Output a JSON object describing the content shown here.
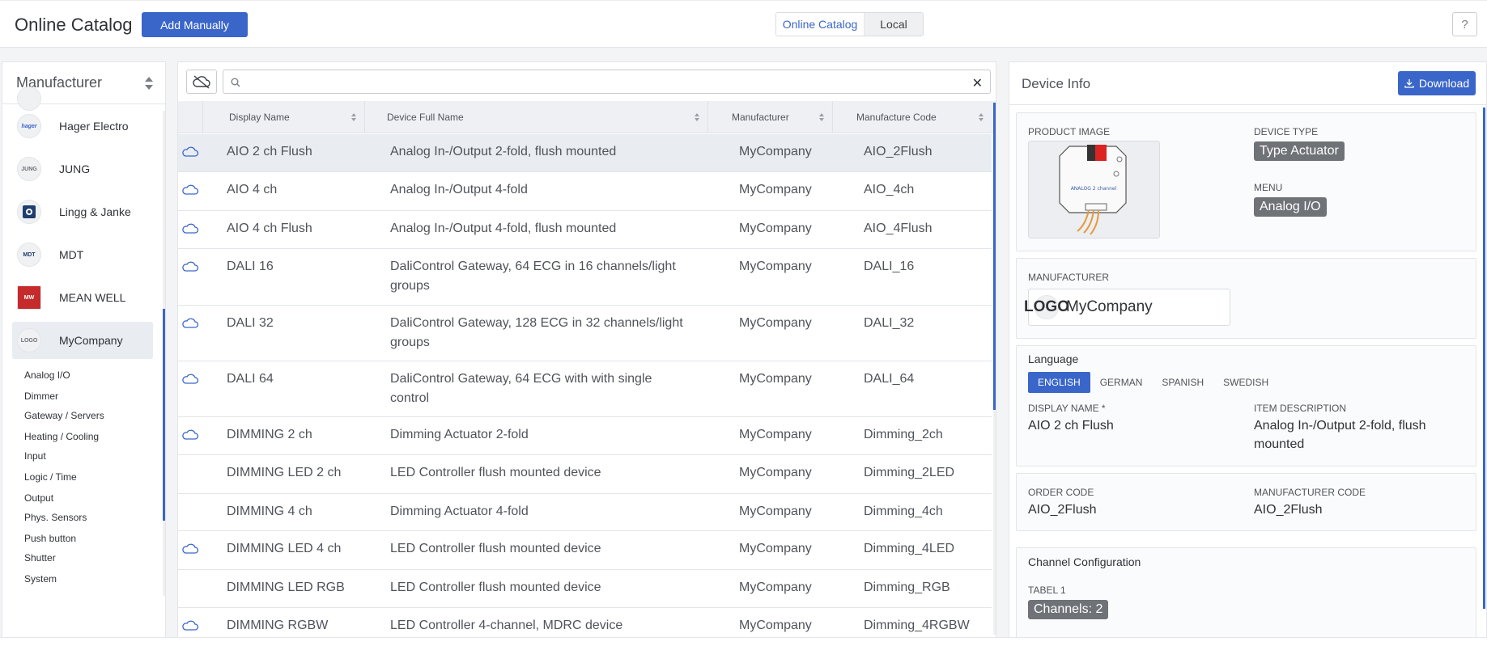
{
  "header": {
    "title": "Online Catalog",
    "add_manually_label": "Add Manually",
    "tabs": [
      "Online Catalog",
      "Local"
    ],
    "help_label": "?"
  },
  "left": {
    "header": "Manufacturer",
    "manufacturers": [
      {
        "name": "Hager Electro",
        "logo": "hager"
      },
      {
        "name": "JUNG",
        "logo": "JUNG"
      },
      {
        "name": "Lingg & Janke",
        "logo": ""
      },
      {
        "name": "MDT",
        "logo": "MDT"
      },
      {
        "name": "MEAN WELL",
        "logo": "MW"
      },
      {
        "name": "MyCompany",
        "logo": "LOGO"
      }
    ],
    "categories": [
      "Analog I/O",
      "Dimmer",
      "Gateway / Servers",
      "Heating / Cooling",
      "Input",
      "Logic / Time",
      "Output",
      "Phys. Sensors",
      "Push button",
      "Shutter",
      "System"
    ]
  },
  "middle": {
    "search_placeholder": "",
    "columns": [
      "Display Name",
      "Device Full Name",
      "Manufacturer",
      "Manufacture Code"
    ],
    "rows": [
      {
        "display": "AIO 2 ch Flush",
        "full": "Analog In-/Output 2-fold, flush mounted",
        "full2": "",
        "mfr": "MyCompany",
        "code": "AIO_2Flush",
        "cloud": true
      },
      {
        "display": "AIO 4 ch",
        "full": "Analog In-/Output 4-fold",
        "full2": "",
        "mfr": "MyCompany",
        "code": "AIO_4ch",
        "cloud": true
      },
      {
        "display": "AIO 4 ch Flush",
        "full": "Analog In-/Output 4-fold, flush mounted",
        "full2": "",
        "mfr": "MyCompany",
        "code": "AIO_4Flush",
        "cloud": true
      },
      {
        "display": "DALI 16",
        "full": "DaliControl Gateway, 64 ECG in 16 channels/light",
        "full2": "groups",
        "mfr": "MyCompany",
        "code": "DALI_16",
        "cloud": true
      },
      {
        "display": "DALI 32",
        "full": "DaliControl Gateway, 128 ECG in 32 channels/light",
        "full2": "groups",
        "mfr": "MyCompany",
        "code": "DALI_32",
        "cloud": true
      },
      {
        "display": "DALI 64",
        "full": "DaliControl Gateway, 64 ECG with with single",
        "full2": "control",
        "mfr": "MyCompany",
        "code": "DALI_64",
        "cloud": true
      },
      {
        "display": "DIMMING 2 ch",
        "full": "Dimming Actuator 2-fold",
        "full2": "",
        "mfr": "MyCompany",
        "code": "Dimming_2ch",
        "cloud": true
      },
      {
        "display": "DIMMING LED 2 ch",
        "full": "LED Controller flush mounted device",
        "full2": "",
        "mfr": "MyCompany",
        "code": "Dimming_2LED",
        "cloud": false
      },
      {
        "display": "DIMMING 4 ch",
        "full": "Dimming Actuator 4-fold",
        "full2": "",
        "mfr": "MyCompany",
        "code": "Dimming_4ch",
        "cloud": false
      },
      {
        "display": "DIMMING LED 4 ch",
        "full": "LED Controller flush mounted device",
        "full2": "",
        "mfr": "MyCompany",
        "code": "Dimming_4LED",
        "cloud": true
      },
      {
        "display": "DIMMING LED RGB",
        "full": "LED Controller flush mounted device",
        "full2": "",
        "mfr": "MyCompany",
        "code": "Dimming_RGB",
        "cloud": false
      },
      {
        "display": "DIMMING RGBW",
        "full": "LED Controller 4-channel, MDRC device",
        "full2": "",
        "mfr": "MyCompany",
        "code": "Dimming_4RGBW",
        "cloud": true
      }
    ]
  },
  "right": {
    "title": "Device Info",
    "download_label": "Download",
    "product_image_label": "PRODUCT IMAGE",
    "product_image_text": "ANALOG 2 channel",
    "device_type_label": "DEVICE TYPE",
    "device_type_value": "Type Actuator",
    "menu_label": "MENU",
    "menu_value": "Analog I/O",
    "manufacturer_label": "MANUFACTURER",
    "manufacturer_value": "MyCompany",
    "manufacturer_logo": "LOGO",
    "language_label": "Language",
    "languages": [
      "ENGLISH",
      "GERMAN",
      "SPANISH",
      "SWEDISH"
    ],
    "display_name_label": "DISPLAY NAME *",
    "display_name_value": "AIO 2 ch Flush",
    "item_desc_label": "ITEM DESCRIPTION",
    "item_desc_line1": "Analog In-/Output 2-fold, flush",
    "item_desc_line2": "mounted",
    "order_code_label": "ORDER CODE",
    "order_code_value": "AIO_2Flush",
    "mfr_code_label": "MANUFACTURER CODE",
    "mfr_code_value": "AIO_2Flush",
    "channel_config_label": "Channel Configuration",
    "tabel_label": "TABEL 1",
    "channels_value": "Channels: 2"
  },
  "colors": {
    "accent": "#3a66c9",
    "tag": "#6f7276",
    "selected_row": "#e9ecf1"
  }
}
